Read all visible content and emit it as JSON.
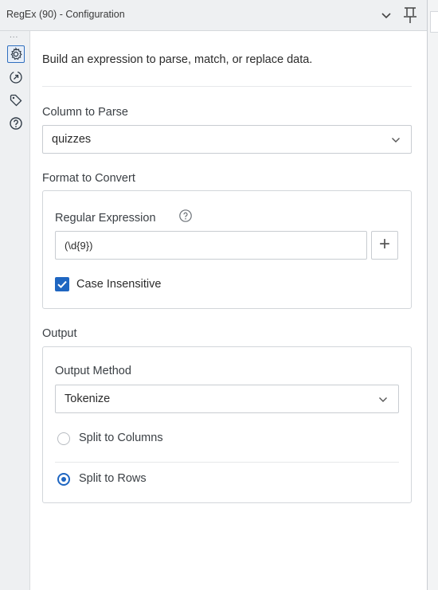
{
  "window": {
    "title": "RegEx (90) - Configuration"
  },
  "rail": {
    "overflow": "...",
    "icons": [
      "gear-icon",
      "annotation-icon",
      "tag-icon",
      "help-icon"
    ]
  },
  "main": {
    "description": "Build an expression to parse, match, or replace data.",
    "column_to_parse": {
      "label": "Column to Parse",
      "value": "quizzes"
    },
    "format_to_convert": {
      "label": "Format to Convert",
      "regex_label": "Regular Expression",
      "regex_value": "(\\d{9})",
      "add_symbol": "+",
      "case_insensitive_label": "Case Insensitive",
      "case_insensitive_checked": true
    },
    "output": {
      "label": "Output",
      "method_label": "Output Method",
      "method_value": "Tokenize",
      "options": [
        {
          "label": "Split to Columns",
          "selected": false
        },
        {
          "label": "Split to Rows",
          "selected": true
        }
      ]
    }
  },
  "colors": {
    "accent": "#1f66c1",
    "panel": "#eef0f2",
    "border": "#c8ccd1"
  }
}
